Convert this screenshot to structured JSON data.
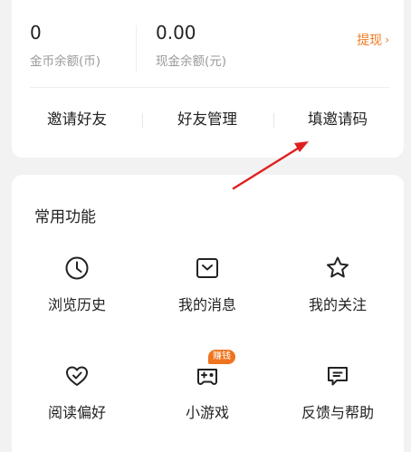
{
  "wallet": {
    "coins_value": "0",
    "coins_label": "金币余额(币)",
    "cash_value": "0.00",
    "cash_label": "现金余额(元)",
    "withdraw_label": "提现"
  },
  "friend_actions": [
    {
      "label": "邀请好友"
    },
    {
      "label": "好友管理"
    },
    {
      "label": "填邀请码"
    }
  ],
  "features": {
    "title": "常用功能",
    "items": [
      {
        "label": "浏览历史",
        "icon": "clock-icon"
      },
      {
        "label": "我的消息",
        "icon": "message-icon"
      },
      {
        "label": "我的关注",
        "icon": "star-icon"
      },
      {
        "label": "阅读偏好",
        "icon": "heart-check-icon"
      },
      {
        "label": "小游戏",
        "icon": "gamepad-icon",
        "badge": "赚钱"
      },
      {
        "label": "反馈与帮助",
        "icon": "feedback-icon"
      }
    ]
  },
  "colors": {
    "accent": "#f07a22",
    "badge": "#f0741e",
    "annotation_arrow": "#e02020"
  }
}
